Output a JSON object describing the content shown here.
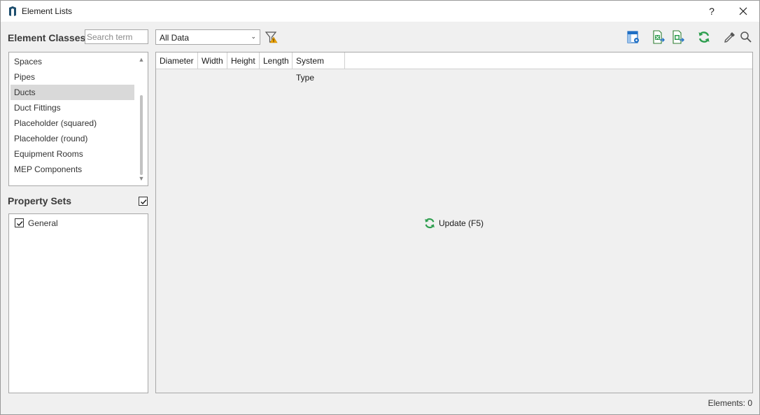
{
  "window": {
    "title": "Element Lists",
    "help_label": "?"
  },
  "element_classes": {
    "title": "Element Classes",
    "search_placeholder": "Search term",
    "items": [
      {
        "label": "Spaces",
        "selected": false
      },
      {
        "label": "Pipes",
        "selected": false
      },
      {
        "label": "Ducts",
        "selected": true
      },
      {
        "label": "Duct Fittings",
        "selected": false
      },
      {
        "label": "Placeholder (squared)",
        "selected": false
      },
      {
        "label": "Placeholder (round)",
        "selected": false
      },
      {
        "label": "Equipment Rooms",
        "selected": false
      },
      {
        "label": "MEP Components",
        "selected": false
      }
    ]
  },
  "property_sets": {
    "title": "Property Sets",
    "select_all_checked": true,
    "items": [
      {
        "label": "General",
        "checked": true
      }
    ]
  },
  "toolbar": {
    "filter_value": "All Data",
    "icons": [
      "filter-warning-icon",
      "column-settings-icon",
      "export-excel-icon",
      "export-excel-2-icon",
      "refresh-icon",
      "eyedropper-icon",
      "search-icon"
    ]
  },
  "grid": {
    "columns": [
      "Diameter",
      "Width",
      "Height",
      "Length",
      "System Type"
    ],
    "update_label": "Update (F5)"
  },
  "status": {
    "elements_label": "Elements: 0"
  },
  "colors": {
    "accent_green": "#2e9e4f",
    "accent_blue": "#1f6fc5",
    "selection": "#d9d9d9",
    "warning": "#f0a500"
  }
}
